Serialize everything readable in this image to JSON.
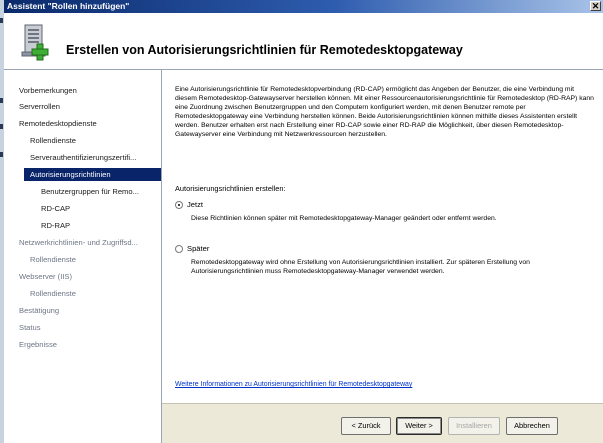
{
  "window": {
    "title": "Assistent \"Rollen hinzufügen\"",
    "close_glyph": "✕"
  },
  "header": {
    "title": "Erstellen von Autorisierungsrichtlinien für Remotedesktopgateway",
    "icon": "server-add-icon"
  },
  "sidebar": {
    "items": [
      {
        "label": "Vorbemerkungen",
        "state": "done"
      },
      {
        "label": "Serverrollen",
        "state": "done"
      },
      {
        "label": "Remotedesktopdienste",
        "state": "done"
      },
      {
        "label": "Rollendienste",
        "state": "done"
      },
      {
        "label": "Serverauthentifizierungszertifi...",
        "state": "done"
      },
      {
        "label": "Autorisierungsrichtlinien",
        "state": "active"
      },
      {
        "label": "Benutzergruppen für Remo...",
        "state": "done"
      },
      {
        "label": "RD-CAP",
        "state": "done"
      },
      {
        "label": "RD-RAP",
        "state": "done"
      },
      {
        "label": "Netzwerkrichtlinien- und Zugriffsd...",
        "state": "dim"
      },
      {
        "label": "Rollendienste",
        "state": "dim"
      },
      {
        "label": "Webserver (IIS)",
        "state": "dim"
      },
      {
        "label": "Rollendienste",
        "state": "dim"
      },
      {
        "label": "Bestätigung",
        "state": "dim"
      },
      {
        "label": "Status",
        "state": "dim"
      },
      {
        "label": "Ergebnisse",
        "state": "dim"
      }
    ]
  },
  "main": {
    "intro": "Eine Autorisierungsrichtlinie für Remotedesktopverbindung (RD-CAP) ermöglicht das Angeben der Benutzer, die eine Verbindung mit diesem Remotedesktop-Gatewayserver herstellen können. Mit einer Ressourcenautorisierungsrichtlinie für Remotedesktop (RD-RAP) kann eine Zuordnung zwischen Benutzergruppen und den Computern konfiguriert werden, mit denen Benutzer remote per Remotedesktopgateway eine Verbindung herstellen können. Beide Autorisierungsrichtlinien können mithilfe dieses Assistenten erstellt werden. Benutzer erhalten erst nach Erstellung einer RD-CAP sowie einer RD-RAP die Möglichkeit, über diesen Remotedesktop-Gatewayserver eine Verbindung mit Netzwerkressourcen herzustellen.",
    "create_label": "Autorisierungsrichtlinien erstellen:",
    "option_now": {
      "label": "Jetzt",
      "selected": true,
      "description": "Diese Richtlinien können später mit Remotedesktopgateway-Manager geändert oder entfernt werden."
    },
    "option_later": {
      "label": "Später",
      "selected": false,
      "description": "Remotedesktopgateway wird ohne Erstellung von Autorisierungsrichtlinien installiert. Zur späteren Erstellung von Autorisierungsrichtlinien muss Remotedesktopgateway-Manager verwendet werden."
    },
    "more_info_link": "Weitere Informationen zu Autorisierungsrichtlinien für Remotedesktopgateway"
  },
  "footer": {
    "back": "< Zurück",
    "next": "Weiter >",
    "install": "Installieren",
    "cancel": "Abbrechen"
  },
  "colors": {
    "selection": "#0a246a",
    "link": "#0033cc",
    "footer_bg": "#ece9d8"
  }
}
